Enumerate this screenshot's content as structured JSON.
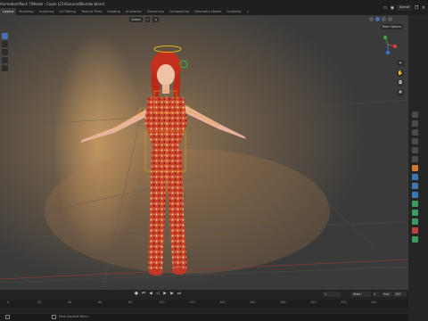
{
  "window": {
    "title": "Animation\\Pack 7\\Model - Copie (23)\\Source\\Blender.blend"
  },
  "workspace_tabs": [
    {
      "label": "Layout",
      "active": true
    },
    {
      "label": "Modeling"
    },
    {
      "label": "Sculpting"
    },
    {
      "label": "UV Editing"
    },
    {
      "label": "Texture Paint"
    },
    {
      "label": "Shading"
    },
    {
      "label": "Animation"
    },
    {
      "label": "Rendering"
    },
    {
      "label": "Compositing"
    },
    {
      "label": "Geometry Nodes"
    },
    {
      "label": "Scripting"
    },
    {
      "label": "+"
    }
  ],
  "scene": {
    "label": "Scene"
  },
  "viewport": {
    "header_dropdown": "Global",
    "pose_options": "Pose Options",
    "accent_color": "#4b6fb0"
  },
  "timeline": {
    "current_frame": "1",
    "start_label": "Start",
    "start_value": "1",
    "end_label": "End",
    "end_value": "250",
    "ruler_ticks": [
      "0",
      "20",
      "40",
      "60",
      "80",
      "100",
      "120",
      "140",
      "160",
      "180",
      "200",
      "220",
      "240"
    ]
  },
  "statusbar": {
    "text": "Pose Context Menu"
  },
  "icons": {
    "play": "play-icon",
    "jump_start": "jump-start-icon",
    "jump_end": "jump-end-icon",
    "prev_key": "prev-keyframe-icon",
    "next_key": "next-keyframe-icon",
    "zoom": "zoom-icon",
    "hand": "pan-icon",
    "camera": "camera-icon",
    "grid": "grid-icon"
  }
}
